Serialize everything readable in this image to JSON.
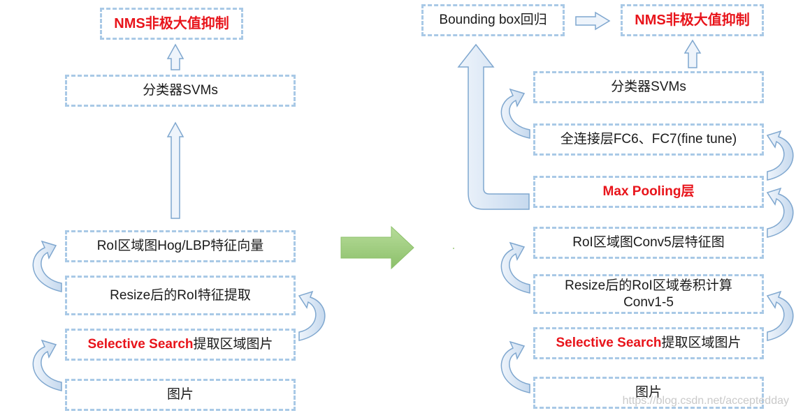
{
  "left": {
    "nms": "NMS非极大值抑制",
    "svm": "分类器SVMs",
    "features": "RoI区域图Hog/LBP特征向量",
    "resize": "Resize后的RoI特征提取",
    "selective_red": "Selective Search",
    "selective_rest": "提取区域图片",
    "image": "图片"
  },
  "right": {
    "bbox": "Bounding box回归",
    "nms": "NMS非极大值抑制",
    "svm": "分类器SVMs",
    "fc": "全连接层FC6、FC7(fine tune)",
    "maxpool": "Max Pooling层",
    "conv5": "RoI区域图Conv5层特征图",
    "resize_line1": "Resize后的RoI区域卷积计算",
    "resize_line2": "Conv1-5",
    "selective_red": "Selective Search",
    "selective_rest": "提取区域图片",
    "image": "图片"
  },
  "watermark": "https://blog.csdn.net/acceptedday",
  "colors": {
    "box_border": "#a9c9e6",
    "arrow_fill": "#dbe8f5",
    "arrow_stroke": "#7fa7cf",
    "transition_arrow": "#9cc97b",
    "highlight_text": "#e8141b"
  }
}
